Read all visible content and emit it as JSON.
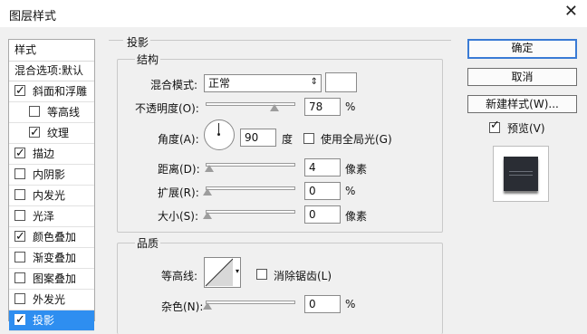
{
  "dialog": {
    "title": "图层样式",
    "close_glyph": "✕"
  },
  "left_panel": {
    "header": "样式",
    "blend_options": "混合选项:默认",
    "items": [
      {
        "label": "斜面和浮雕",
        "checked": true,
        "sub": false
      },
      {
        "label": "等高线",
        "checked": false,
        "sub": true
      },
      {
        "label": "纹理",
        "checked": true,
        "sub": true
      },
      {
        "label": "描边",
        "checked": true,
        "sub": false
      },
      {
        "label": "内阴影",
        "checked": false,
        "sub": false
      },
      {
        "label": "内发光",
        "checked": false,
        "sub": false
      },
      {
        "label": "光泽",
        "checked": false,
        "sub": false
      },
      {
        "label": "颜色叠加",
        "checked": true,
        "sub": false
      },
      {
        "label": "渐变叠加",
        "checked": false,
        "sub": false
      },
      {
        "label": "图案叠加",
        "checked": false,
        "sub": false
      },
      {
        "label": "外发光",
        "checked": false,
        "sub": false
      },
      {
        "label": "投影",
        "checked": true,
        "sub": false,
        "active": true
      }
    ]
  },
  "main": {
    "section_title": "投影",
    "structure": {
      "title": "结构",
      "blend_mode_label": "混合模式:",
      "blend_mode_value": "正常",
      "blend_color": "#ffffff",
      "opacity_label": "不透明度(O):",
      "opacity_value": "78",
      "opacity_unit": "%",
      "opacity_level": 0.78,
      "angle_label": "角度(A):",
      "angle_value": "90",
      "angle_unit": "度",
      "global_light_label": "使用全局光(G)",
      "global_light_checked": false,
      "distance_label": "距离(D):",
      "distance_value": "4",
      "distance_unit": "像素",
      "distance_level": 0.02,
      "spread_label": "扩展(R):",
      "spread_value": "0",
      "spread_unit": "%",
      "spread_level": 0,
      "size_label": "大小(S):",
      "size_value": "0",
      "size_unit": "像素",
      "size_level": 0
    },
    "quality": {
      "title": "品质",
      "contour_label": "等高线:",
      "antialias_label": "消除锯齿(L)",
      "antialias_checked": false,
      "noise_label": "杂色(N):",
      "noise_value": "0",
      "noise_unit": "%",
      "noise_level": 0
    }
  },
  "right_panel": {
    "ok": "确定",
    "cancel": "取消",
    "new_style": "新建样式(W)...",
    "preview_label": "预览(V)",
    "preview_checked": true
  }
}
